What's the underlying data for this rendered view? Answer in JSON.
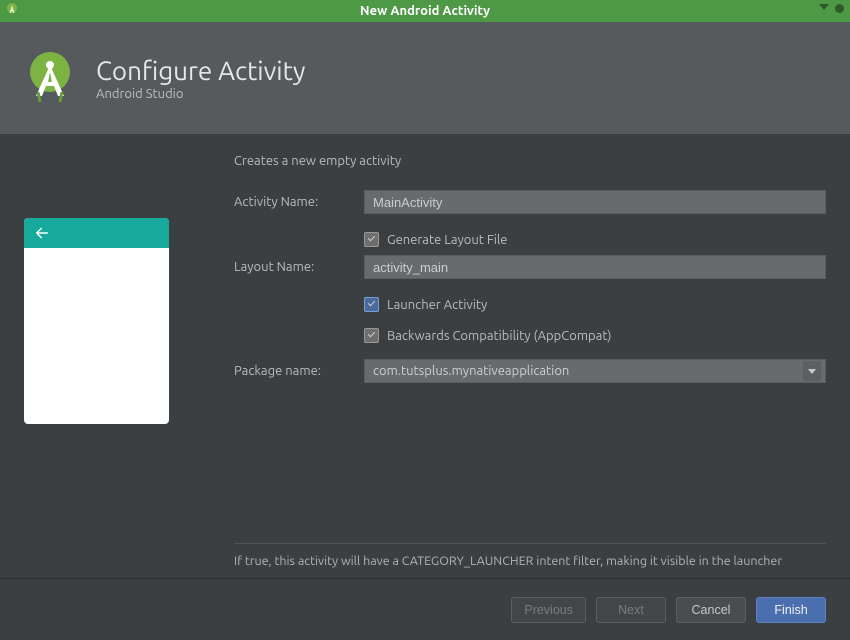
{
  "window": {
    "title": "New Android Activity"
  },
  "banner": {
    "title": "Configure Activity",
    "subtitle": "Android Studio"
  },
  "form": {
    "description": "Creates a new empty activity",
    "activity_name_label": "Activity Name:",
    "activity_name_value": "MainActivity",
    "generate_layout_label": "Generate Layout File",
    "layout_name_label": "Layout Name:",
    "layout_name_value": "activity_main",
    "launcher_activity_label": "Launcher Activity",
    "backwards_compat_label": "Backwards Compatibility (AppCompat)",
    "package_name_label": "Package name:",
    "package_name_value": "com.tutsplus.mynativeapplication",
    "hint": "If true, this activity will have a CATEGORY_LAUNCHER intent filter, making it visible in the launcher"
  },
  "footer": {
    "previous": "Previous",
    "next": "Next",
    "cancel": "Cancel",
    "finish": "Finish"
  }
}
